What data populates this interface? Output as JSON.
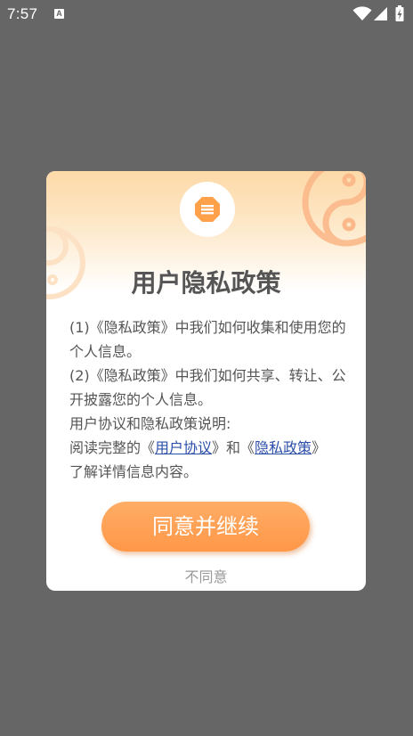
{
  "status_bar": {
    "time": "7:57",
    "notification_icon": "a-letter-icon",
    "notification_letter": "A",
    "icons": [
      "wifi-icon",
      "signal-icon",
      "battery-icon"
    ]
  },
  "dialog": {
    "title": "用户隐私政策",
    "header_icon": "document-lines-icon",
    "body": {
      "line1": "(1)《隐私政策》中我们如何收集和使用您的个人信息。",
      "line2": "(2)《隐私政策》中我们如何共享、转让、公开披露您的个人信息。",
      "line3": "用户协议和隐私政策说明:",
      "line4_prefix": "阅读完整的《",
      "link_user_agreement": "用户协议",
      "line4_middle": "》和《",
      "link_privacy_policy": "隐私政策",
      "line4_suffix": "》",
      "line5": "了解详情信息内容。"
    },
    "agree_label": "同意并继续",
    "disagree_label": "不同意"
  },
  "colors": {
    "overlay": "#666666",
    "accent": "#ff9d50",
    "link": "#2b4fa8",
    "text": "#555555",
    "muted": "#999999"
  }
}
